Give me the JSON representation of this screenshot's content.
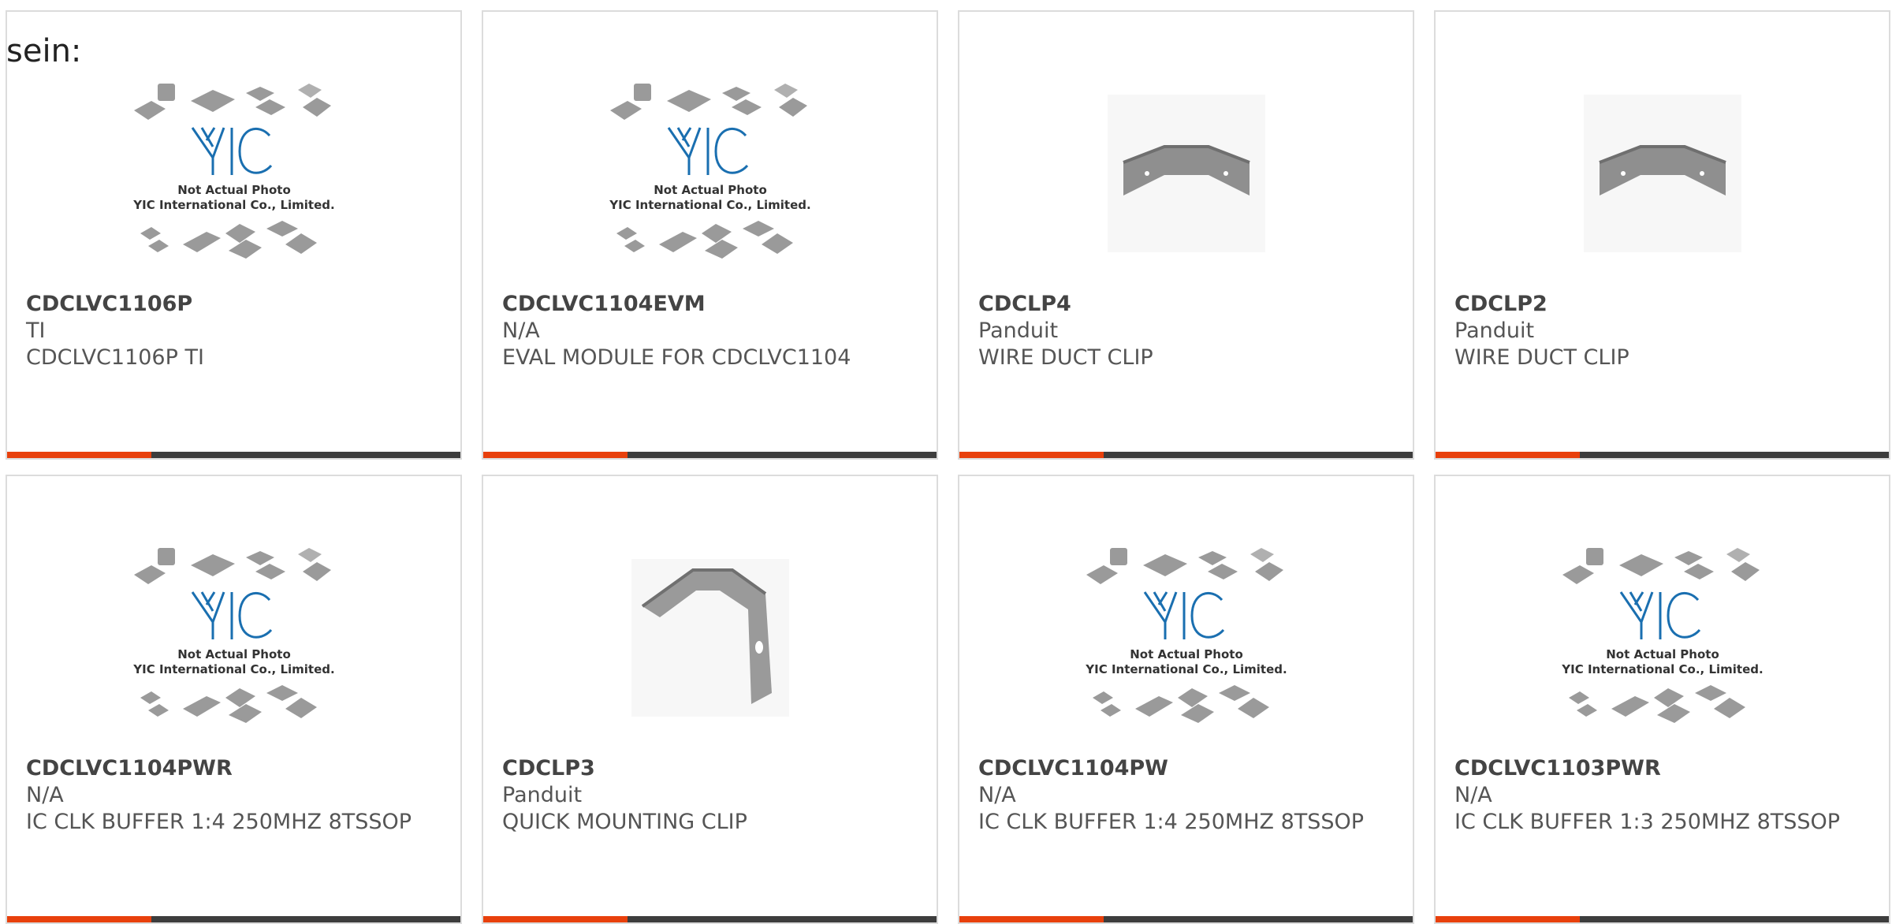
{
  "intro": {
    "text": "sein:"
  },
  "colors": {
    "accent": "#e8400c",
    "bar": "#3d3d3d",
    "border": "#dcdcdc",
    "logo": "#1a6fb0"
  },
  "placeholder": {
    "line1": "Not Actual Photo",
    "line2": "YIC International Co., Limited."
  },
  "products": [
    {
      "part": "CDCLVC1106P",
      "maker": "TI",
      "desc": "CDCLVC1106P TI",
      "image": "yic-placeholder-icon"
    },
    {
      "part": "CDCLVC1104EVM",
      "maker": "N/A",
      "desc": "EVAL MODULE FOR CDCLVC1104",
      "image": "yic-placeholder-icon"
    },
    {
      "part": "CDCLP4",
      "maker": "Panduit",
      "desc": "WIRE DUCT CLIP",
      "image": "wire-duct-clip-photo"
    },
    {
      "part": "CDCLP2",
      "maker": "Panduit",
      "desc": "WIRE DUCT CLIP",
      "image": "wire-duct-clip-photo"
    },
    {
      "part": "CDCLVC1104PWR",
      "maker": "N/A",
      "desc": "IC CLK BUFFER 1:4 250MHZ 8TSSOP",
      "image": "yic-placeholder-icon"
    },
    {
      "part": "CDCLP3",
      "maker": "Panduit",
      "desc": "QUICK MOUNTING CLIP",
      "image": "mounting-clip-photo"
    },
    {
      "part": "CDCLVC1104PW",
      "maker": "N/A",
      "desc": "IC CLK BUFFER 1:4 250MHZ 8TSSOP",
      "image": "yic-placeholder-icon"
    },
    {
      "part": "CDCLVC1103PWR",
      "maker": "N/A",
      "desc": "IC CLK BUFFER 1:3 250MHZ 8TSSOP",
      "image": "yic-placeholder-icon"
    }
  ]
}
